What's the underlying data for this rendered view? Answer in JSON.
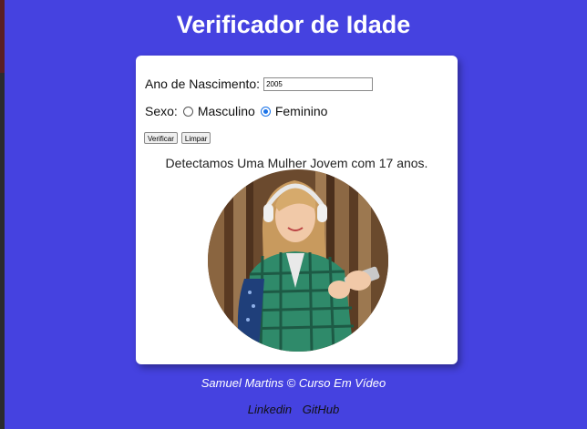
{
  "header": {
    "title": "Verificador de Idade"
  },
  "form": {
    "year_label": "Ano de Nascimento:",
    "year_value": "2005",
    "sex_label": "Sexo:",
    "options": [
      {
        "label": "Masculino",
        "checked": false
      },
      {
        "label": "Feminino",
        "checked": true
      }
    ],
    "verify_label": "Verificar",
    "clear_label": "Limpar"
  },
  "result": {
    "text": "Detectamos Uma Mulher Jovem com 17 anos."
  },
  "footer": {
    "credit": "Samuel Martins © Curso Em Vídeo",
    "links": [
      "Linkedin",
      "GitHub"
    ]
  },
  "colors": {
    "background": "#4542e0",
    "card": "#ffffff",
    "radio_accent": "#1a73e8"
  }
}
